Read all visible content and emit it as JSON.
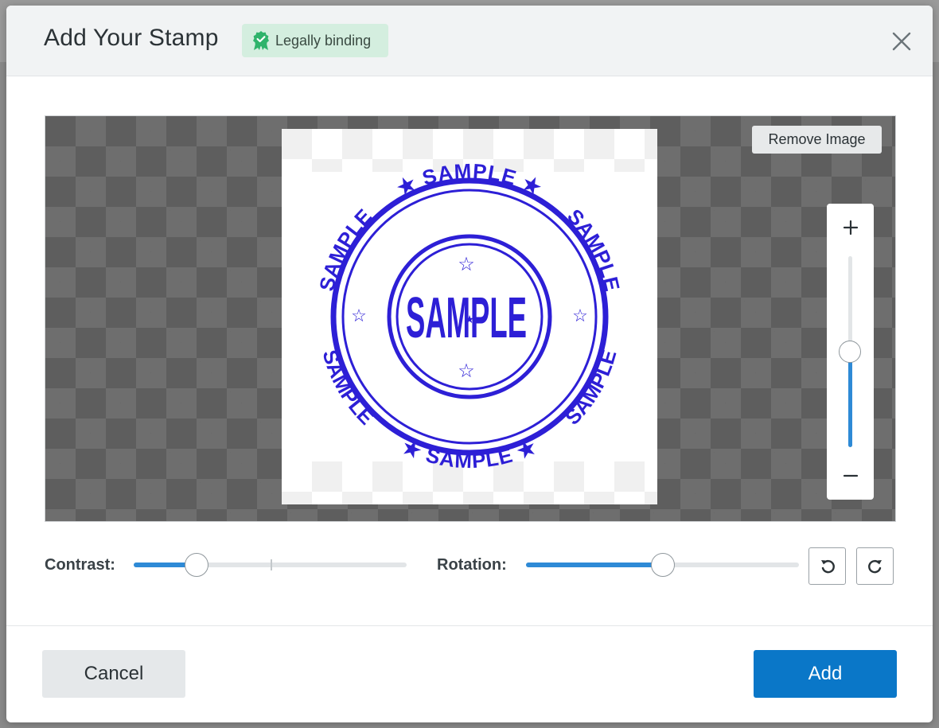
{
  "dialog": {
    "title": "Add Your Stamp",
    "badge": {
      "label": "Legally binding",
      "icon": "verified-badge-icon"
    },
    "close_icon": "close-icon"
  },
  "editor": {
    "remove_image_label": "Remove Image",
    "stamp": {
      "ring_text": "SAMPLE",
      "center_text": "SAMPLE",
      "ink_color": "#2d1fd6"
    },
    "zoom": {
      "plus": "+",
      "minus": "−",
      "level": 0.5
    }
  },
  "controls": {
    "contrast": {
      "label": "Contrast:",
      "value": 0.23,
      "default_mark": 0.5
    },
    "rotation": {
      "label": "Rotation:",
      "value": 0.5
    },
    "rotate_left_icon": "rotate-counterclockwise-icon",
    "rotate_right_icon": "rotate-clockwise-icon"
  },
  "footer": {
    "cancel_label": "Cancel",
    "add_label": "Add"
  },
  "colors": {
    "accent": "#0a77c8",
    "slider_fill": "#2e8ad6",
    "badge_bg": "#d4eedf",
    "badge_icon": "#2fb36b"
  }
}
